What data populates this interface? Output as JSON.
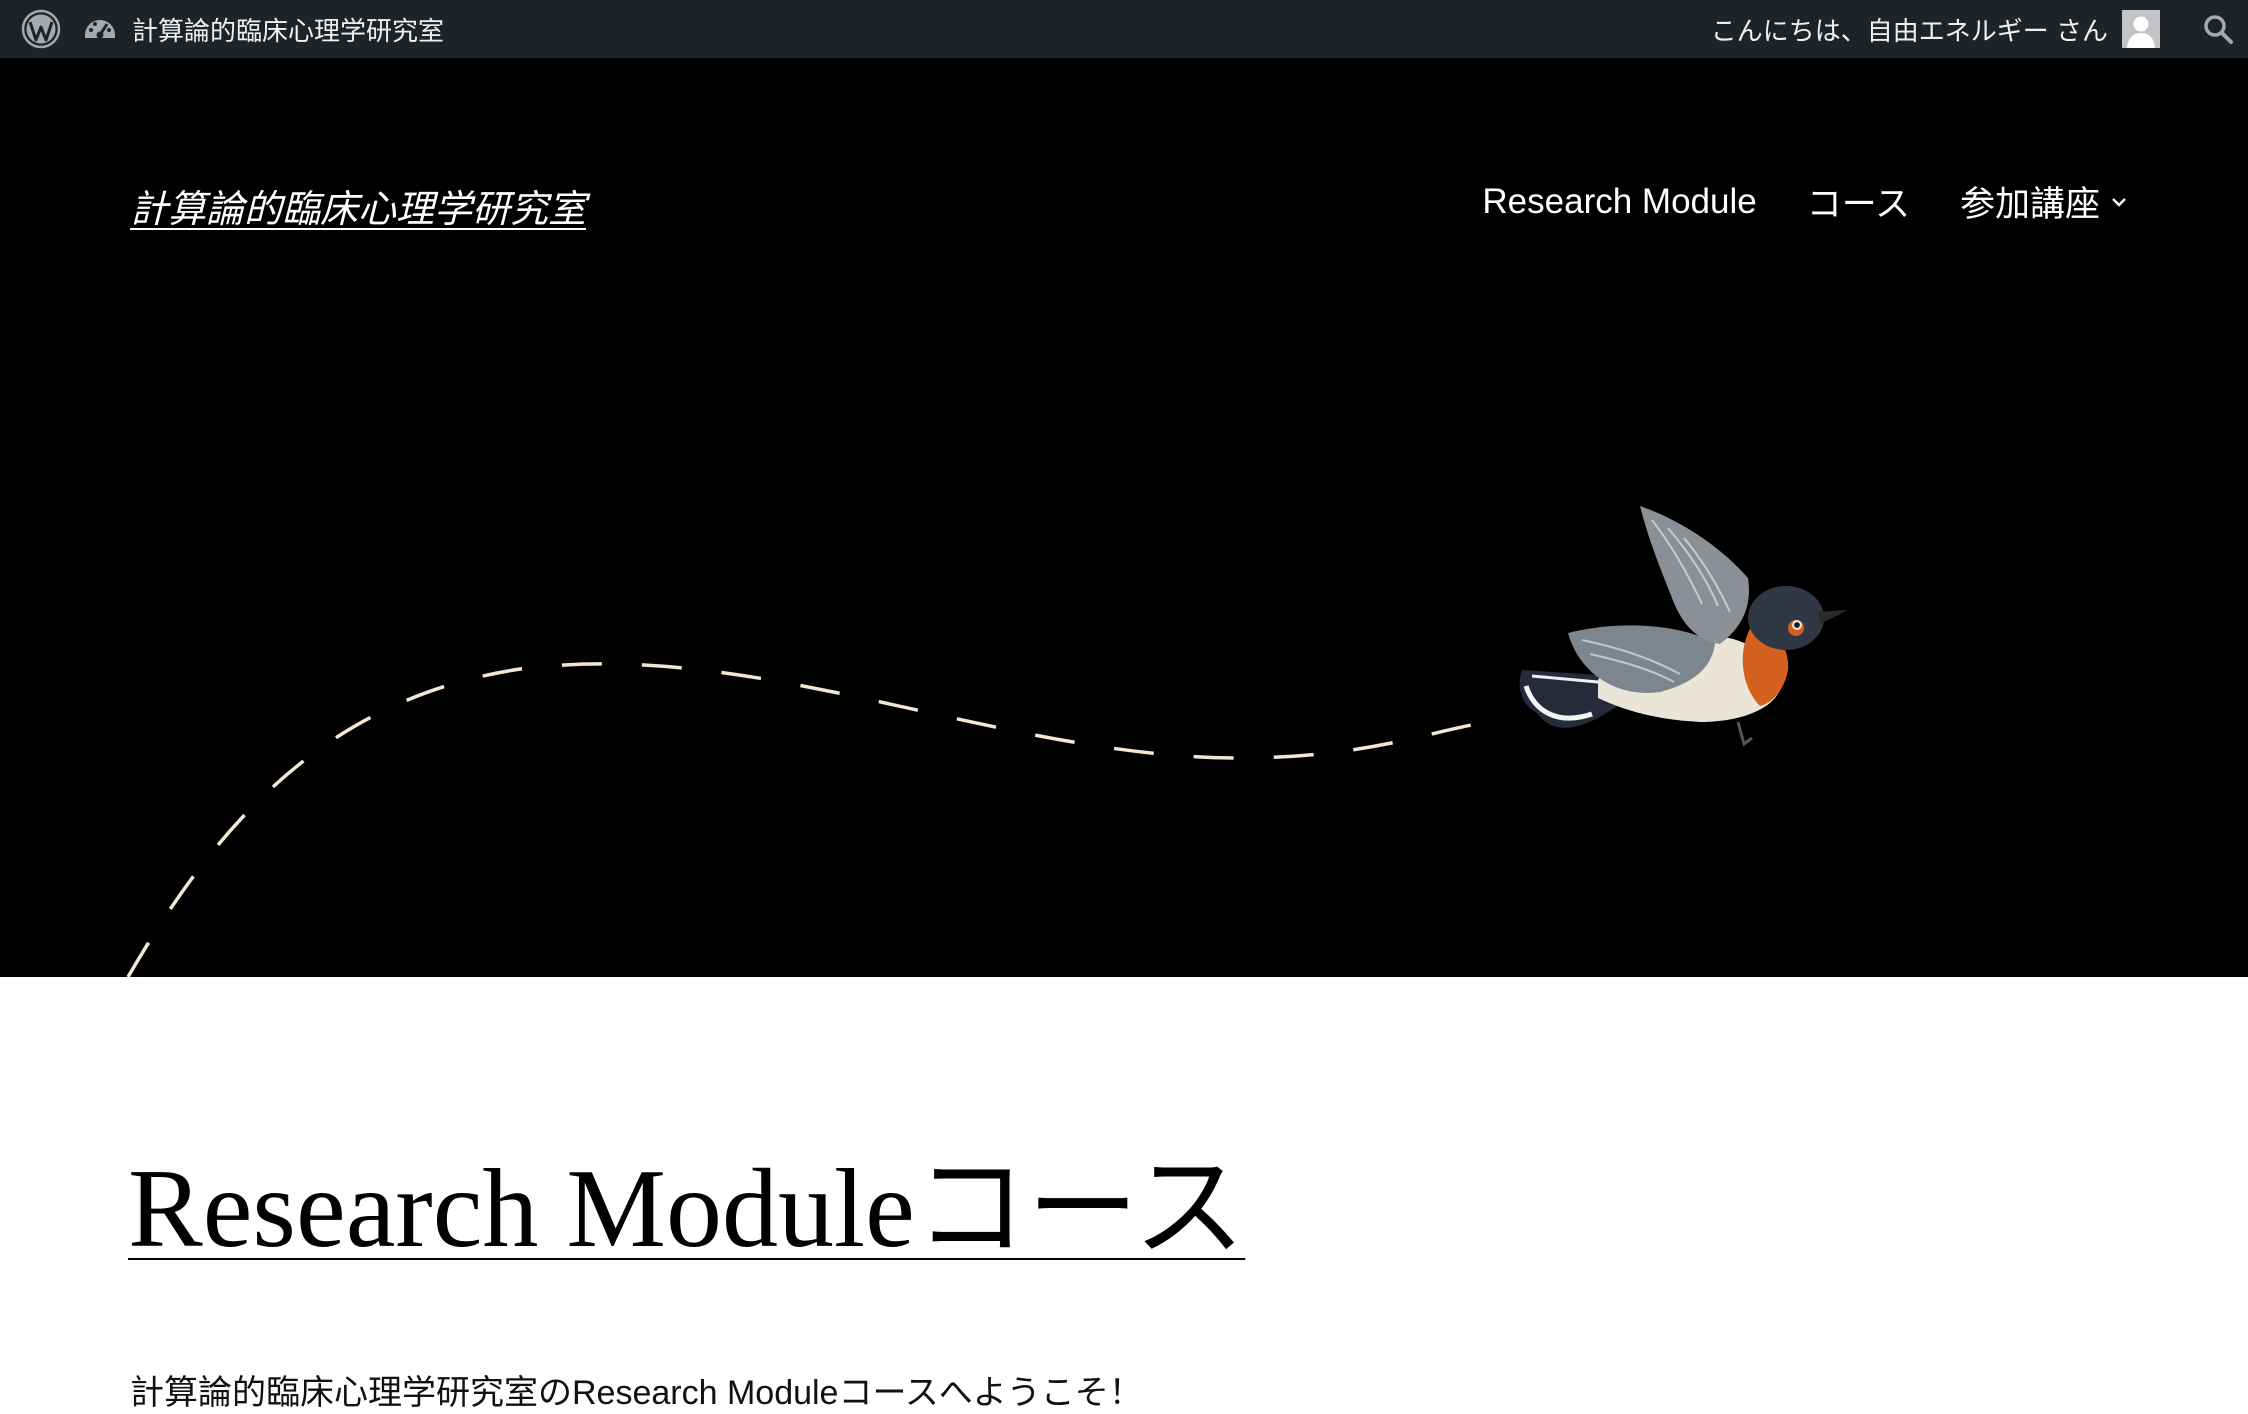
{
  "admin_bar": {
    "site_name": "計算論的臨床心理学研究室",
    "greeting": "こんにちは、自由エネルギー さん",
    "icons": [
      "wordpress-logo-icon",
      "dashboard-icon",
      "user-avatar-icon",
      "search-icon"
    ]
  },
  "header": {
    "site_title": "計算論的臨床心理学研究室",
    "nav": [
      {
        "label": "Research Module"
      },
      {
        "label": "コース"
      },
      {
        "label": "参加講座",
        "has_submenu": true
      }
    ]
  },
  "main": {
    "page_title": "Research Moduleコース",
    "intro": "計算論的臨床心理学研究室のResearch Moduleコースへようこそ！"
  },
  "colors": {
    "admin_bar_bg": "#1d2327",
    "hero_bg": "#000000",
    "dash_line": "#f3e7d3",
    "page_bg": "#ffffff"
  }
}
